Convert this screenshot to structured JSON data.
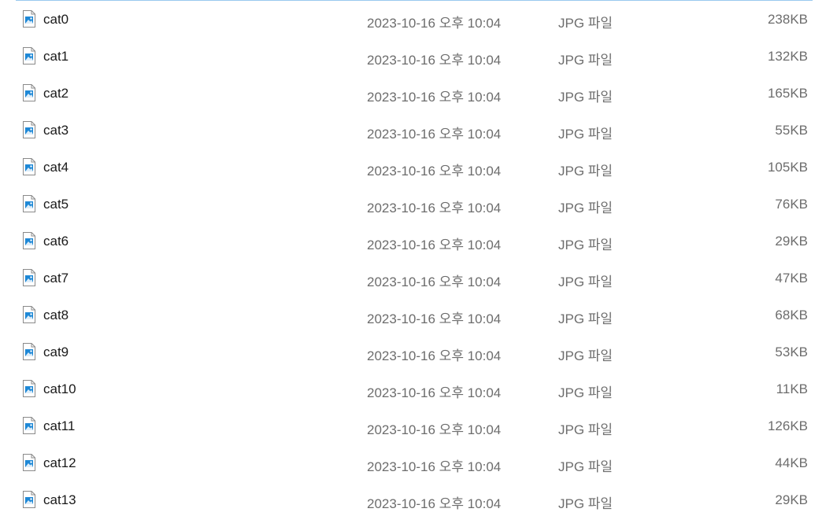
{
  "files": [
    {
      "name": "cat0",
      "modified": "2023-10-16 오후 10:04",
      "type": "JPG 파일",
      "size": "238KB"
    },
    {
      "name": "cat1",
      "modified": "2023-10-16 오후 10:04",
      "type": "JPG 파일",
      "size": "132KB"
    },
    {
      "name": "cat2",
      "modified": "2023-10-16 오후 10:04",
      "type": "JPG 파일",
      "size": "165KB"
    },
    {
      "name": "cat3",
      "modified": "2023-10-16 오후 10:04",
      "type": "JPG 파일",
      "size": "55KB"
    },
    {
      "name": "cat4",
      "modified": "2023-10-16 오후 10:04",
      "type": "JPG 파일",
      "size": "105KB"
    },
    {
      "name": "cat5",
      "modified": "2023-10-16 오후 10:04",
      "type": "JPG 파일",
      "size": "76KB"
    },
    {
      "name": "cat6",
      "modified": "2023-10-16 오후 10:04",
      "type": "JPG 파일",
      "size": "29KB"
    },
    {
      "name": "cat7",
      "modified": "2023-10-16 오후 10:04",
      "type": "JPG 파일",
      "size": "47KB"
    },
    {
      "name": "cat8",
      "modified": "2023-10-16 오후 10:04",
      "type": "JPG 파일",
      "size": "68KB"
    },
    {
      "name": "cat9",
      "modified": "2023-10-16 오후 10:04",
      "type": "JPG 파일",
      "size": "53KB"
    },
    {
      "name": "cat10",
      "modified": "2023-10-16 오후 10:04",
      "type": "JPG 파일",
      "size": "11KB"
    },
    {
      "name": "cat11",
      "modified": "2023-10-16 오후 10:04",
      "type": "JPG 파일",
      "size": "126KB"
    },
    {
      "name": "cat12",
      "modified": "2023-10-16 오후 10:04",
      "type": "JPG 파일",
      "size": "44KB"
    },
    {
      "name": "cat13",
      "modified": "2023-10-16 오후 10:04",
      "type": "JPG 파일",
      "size": "29KB"
    }
  ],
  "icon": {
    "name": "image-file-icon",
    "accent": "#1e88d6"
  }
}
